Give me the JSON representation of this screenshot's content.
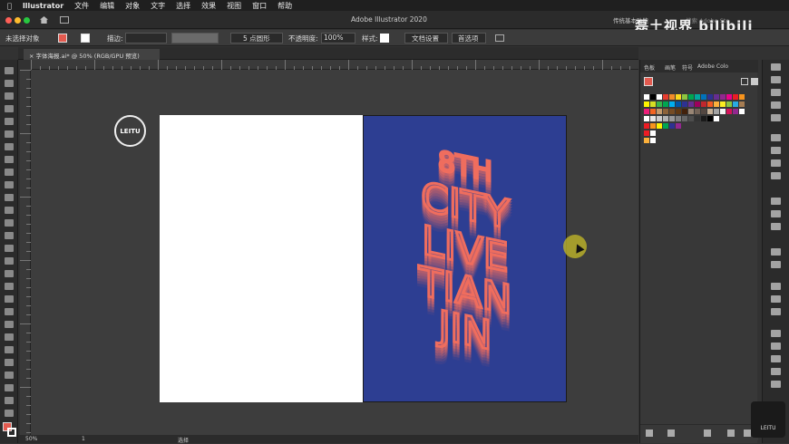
{
  "menubar": {
    "app_name": "Illustrator",
    "items": [
      "文件",
      "编辑",
      "对象",
      "文字",
      "选择",
      "效果",
      "视图",
      "窗口",
      "帮助"
    ]
  },
  "appbar": {
    "title": "Adobe Illustrator 2020",
    "workspace": "传统基本功能",
    "search_placeholder": "搜索 Adobe Sto"
  },
  "watermark": {
    "text": "磊土视界 bilibili"
  },
  "controlbar": {
    "selection_state": "未选择对象",
    "stroke_label": "描边:",
    "brush_label": "5 点圆形",
    "opacity_label": "不透明度:",
    "opacity_value": "100%",
    "style_label": "样式:",
    "doc_settings": "文档设置",
    "preferences": "首选项"
  },
  "tab": {
    "title": "字体海报.ai* @ 50% (RGB/GPU 预览)"
  },
  "ruler": {
    "labels": [
      "0",
      "",
      "",
      "",
      "",
      "",
      "",
      "",
      "",
      ""
    ]
  },
  "artwork": {
    "logo_text": "LEITU",
    "poster_lines": [
      "8TH",
      "CITY",
      "LIVE",
      "TIAN",
      "JIN"
    ],
    "poster_color": "#ef6d5e",
    "background_color": "#2d3e92"
  },
  "status": {
    "zoom": "50%",
    "page": "1",
    "tool": "选择"
  },
  "panel": {
    "tabs": [
      "色板",
      "画笔",
      "符号",
      "Adobe Colo"
    ],
    "swatch_rows": [
      [
        "#ffffff",
        "#000000",
        "#ffffff",
        "#e63c2f",
        "#f28c28",
        "#f9d71c",
        "#8dc63f",
        "#00a651",
        "#00a99d",
        "#0072bc",
        "#2e3192",
        "#662d91",
        "#92278f",
        "#ec008c",
        "#ed1c24",
        "#f7941d"
      ],
      [
        "#fff200",
        "#d7df23",
        "#39b54a",
        "#00a651",
        "#00aeef",
        "#0054a6",
        "#2e3192",
        "#662d91",
        "#9e005d",
        "#c1272d",
        "#f15a24",
        "#fbb03b",
        "#fcee21",
        "#8cc63f",
        "#29abe2",
        "#a67c52"
      ],
      [
        "#ed1e79",
        "#f26522",
        "#c49a6c",
        "#8c6239",
        "#754c24",
        "#603913",
        "#42210b",
        "#998675",
        "#736357",
        "#534741",
        "#c7b299",
        "#a3a3a3",
        "#f5f5f5",
        "#d4145a",
        "#93278f",
        "#ffffff"
      ],
      [
        "#ffffff",
        "#e6e6e6",
        "#cccccc",
        "#b3b3b3",
        "#999999",
        "#808080",
        "#666666",
        "#4d4d4d",
        "#333333",
        "#1a1a1a",
        "#000000",
        "#ffffff"
      ],
      [
        "#ec1c24",
        "#f7941d",
        "#fff200",
        "#00a651",
        "#2e3192",
        "#92278f"
      ],
      [
        "#ec1c24",
        "#ffffff"
      ],
      [
        "#fbb03b",
        "#ffffff"
      ]
    ]
  },
  "badge": {
    "text": "LEITU"
  }
}
